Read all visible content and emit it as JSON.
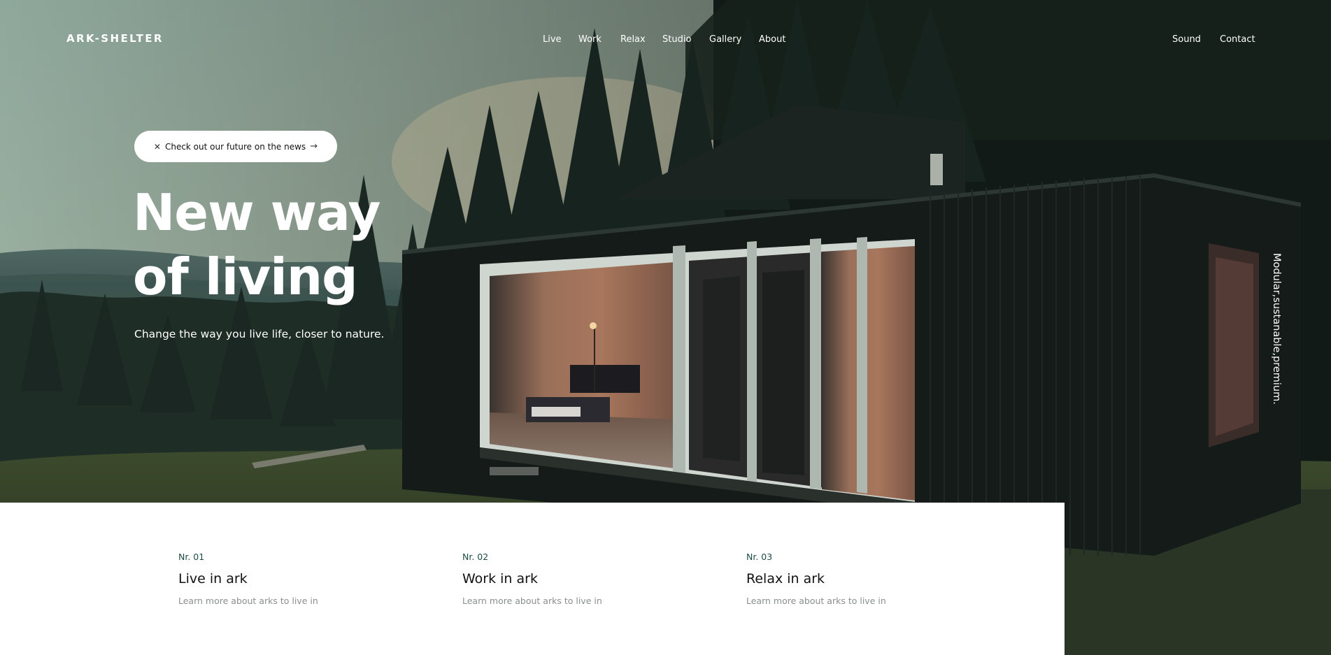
{
  "brand": {
    "logo_text": "ARK-SHELTER"
  },
  "nav": {
    "main_links": [
      "Live",
      "Work",
      "Relax",
      "Studio",
      "Gallery",
      "About"
    ],
    "right_links": [
      "Sound",
      "Contact"
    ]
  },
  "hero": {
    "news_pill": {
      "close_icon": "close-icon",
      "label": "Check out our future on the news",
      "arrow_icon": "arrow-right-icon"
    },
    "title_lines": [
      "New way",
      "of living"
    ],
    "subtitle": "Change the way you live life, closer to nature.",
    "vertical_tagline": "Modular,sustanable,premium."
  },
  "cards": [
    {
      "number": "Nr. 01",
      "title": "Live in ark",
      "link": "Learn more about arks to live in"
    },
    {
      "number": "Nr. 02",
      "title": "Work in ark",
      "link": "Learn more about arks to live in"
    },
    {
      "number": "Nr. 03",
      "title": "Relax in ark",
      "link": "Learn more about arks to live in"
    }
  ],
  "colors": {
    "panel_background": "#ffffff",
    "accent_number": "#1e4b45",
    "muted_link": "#8a8f8d",
    "text_light": "#ffffff"
  }
}
